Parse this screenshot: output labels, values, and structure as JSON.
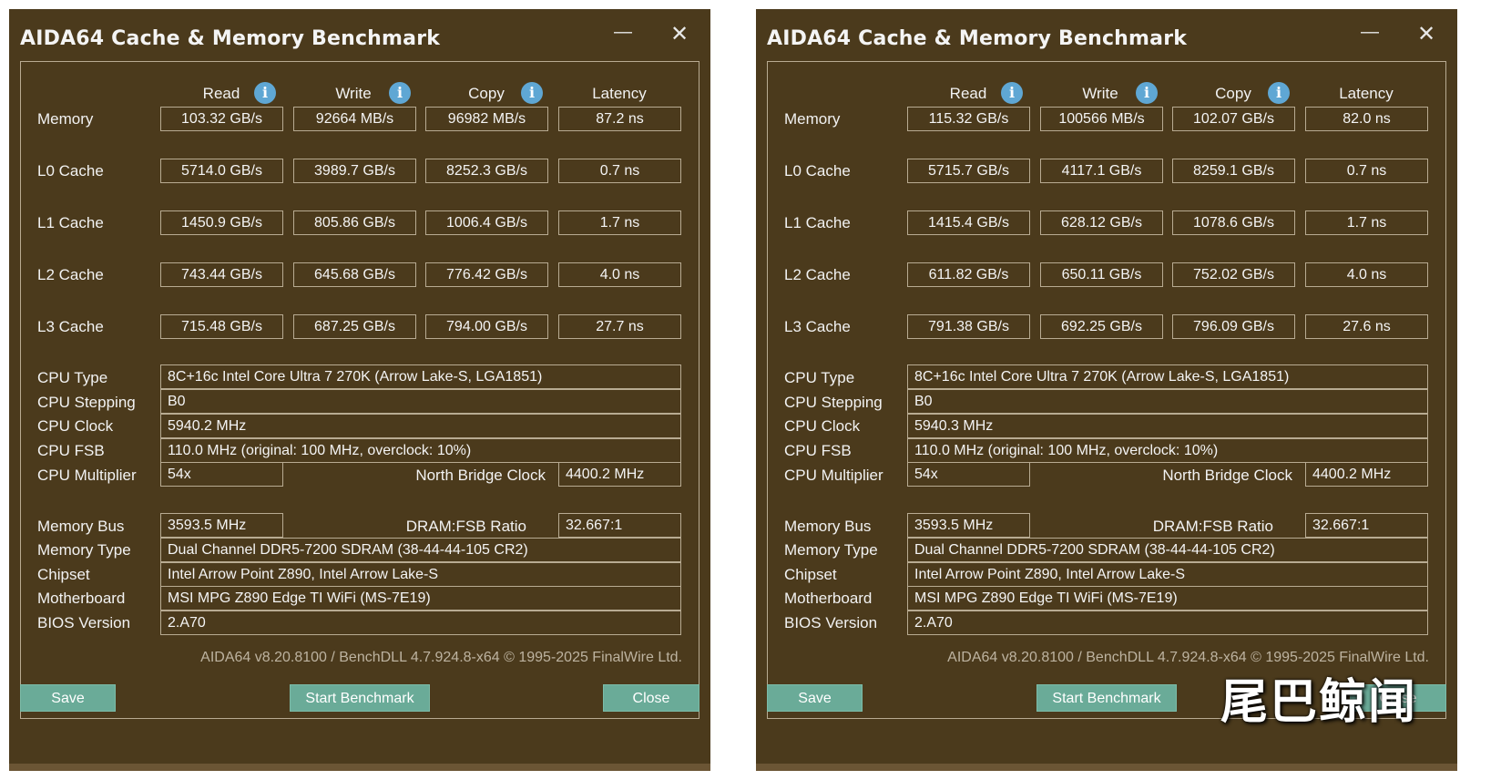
{
  "watermark": "尾巴鲸闻",
  "icons": {
    "info": "info-icon",
    "minimize": "minimize-icon",
    "close": "close-icon"
  },
  "colors": {
    "window_bg": "#4b3a1c",
    "button_bg": "#6aab98",
    "info_icon": "#5fa7d4"
  },
  "windows": [
    {
      "title": "AIDA64 Cache & Memory Benchmark",
      "controls": {
        "minimize": "—",
        "close": "✕"
      },
      "headers": [
        "Read",
        "Write",
        "Copy",
        "Latency"
      ],
      "bench_rows": [
        {
          "label": "Memory",
          "values": [
            "103.32 GB/s",
            "92664 MB/s",
            "96982 MB/s",
            "87.2 ns"
          ]
        },
        {
          "label": "L0 Cache",
          "values": [
            "5714.0 GB/s",
            "3989.7 GB/s",
            "8252.3 GB/s",
            "0.7 ns"
          ]
        },
        {
          "label": "L1 Cache",
          "values": [
            "1450.9 GB/s",
            "805.86 GB/s",
            "1006.4 GB/s",
            "1.7 ns"
          ]
        },
        {
          "label": "L2 Cache",
          "values": [
            "743.44 GB/s",
            "645.68 GB/s",
            "776.42 GB/s",
            "4.0 ns"
          ]
        },
        {
          "label": "L3 Cache",
          "values": [
            "715.48 GB/s",
            "687.25 GB/s",
            "794.00 GB/s",
            "27.7 ns"
          ]
        }
      ],
      "cpu": {
        "type_label": "CPU Type",
        "type": "8C+16c Intel Core Ultra 7 270K  (Arrow Lake-S, LGA1851)",
        "stepping_label": "CPU Stepping",
        "stepping": "B0",
        "clock_label": "CPU Clock",
        "clock": "5940.2 MHz",
        "fsb_label": "CPU FSB",
        "fsb": "110.0 MHz  (original: 100 MHz, overclock: 10%)",
        "multiplier_label": "CPU Multiplier",
        "multiplier": "54x",
        "nb_clock_label": "North Bridge Clock",
        "nb_clock": "4400.2 MHz"
      },
      "memory": {
        "bus_label": "Memory Bus",
        "bus": "3593.5 MHz",
        "ratio_label": "DRAM:FSB Ratio",
        "ratio": "32.667:1",
        "type_label": "Memory Type",
        "type": "Dual Channel DDR5-7200 SDRAM  (38-44-44-105 CR2)",
        "chipset_label": "Chipset",
        "chipset": "Intel Arrow Point Z890, Intel Arrow Lake-S",
        "motherboard_label": "Motherboard",
        "motherboard": "MSI MPG Z890 Edge TI WiFi (MS-7E19)",
        "bios_label": "BIOS Version",
        "bios": "2.A70"
      },
      "footer": "AIDA64 v8.20.8100 / BenchDLL 4.7.924.8-x64 © 1995-2025 FinalWire Ltd.",
      "buttons": {
        "save": "Save",
        "start": "Start Benchmark",
        "close": "Close"
      }
    },
    {
      "title": "AIDA64 Cache & Memory Benchmark",
      "controls": {
        "minimize": "—",
        "close": "✕"
      },
      "headers": [
        "Read",
        "Write",
        "Copy",
        "Latency"
      ],
      "bench_rows": [
        {
          "label": "Memory",
          "values": [
            "115.32 GB/s",
            "100566 MB/s",
            "102.07 GB/s",
            "82.0 ns"
          ]
        },
        {
          "label": "L0 Cache",
          "values": [
            "5715.7 GB/s",
            "4117.1 GB/s",
            "8259.1 GB/s",
            "0.7 ns"
          ]
        },
        {
          "label": "L1 Cache",
          "values": [
            "1415.4 GB/s",
            "628.12 GB/s",
            "1078.6 GB/s",
            "1.7 ns"
          ]
        },
        {
          "label": "L2 Cache",
          "values": [
            "611.82 GB/s",
            "650.11 GB/s",
            "752.02 GB/s",
            "4.0 ns"
          ]
        },
        {
          "label": "L3 Cache",
          "values": [
            "791.38 GB/s",
            "692.25 GB/s",
            "796.09 GB/s",
            "27.6 ns"
          ]
        }
      ],
      "cpu": {
        "type_label": "CPU Type",
        "type": "8C+16c Intel Core Ultra 7 270K  (Arrow Lake-S, LGA1851)",
        "stepping_label": "CPU Stepping",
        "stepping": "B0",
        "clock_label": "CPU Clock",
        "clock": "5940.3 MHz",
        "fsb_label": "CPU FSB",
        "fsb": "110.0 MHz  (original: 100 MHz, overclock: 10%)",
        "multiplier_label": "CPU Multiplier",
        "multiplier": "54x",
        "nb_clock_label": "North Bridge Clock",
        "nb_clock": "4400.2 MHz"
      },
      "memory": {
        "bus_label": "Memory Bus",
        "bus": "3593.5 MHz",
        "ratio_label": "DRAM:FSB Ratio",
        "ratio": "32.667:1",
        "type_label": "Memory Type",
        "type": "Dual Channel DDR5-7200 SDRAM  (38-44-44-105 CR2)",
        "chipset_label": "Chipset",
        "chipset": "Intel Arrow Point Z890, Intel Arrow Lake-S",
        "motherboard_label": "Motherboard",
        "motherboard": "MSI MPG Z890 Edge TI WiFi (MS-7E19)",
        "bios_label": "BIOS Version",
        "bios": "2.A70"
      },
      "footer": "AIDA64 v8.20.8100 / BenchDLL 4.7.924.8-x64 © 1995-2025 FinalWire Ltd.",
      "buttons": {
        "save": "Save",
        "start": "Start Benchmark",
        "close": "Close"
      }
    }
  ]
}
